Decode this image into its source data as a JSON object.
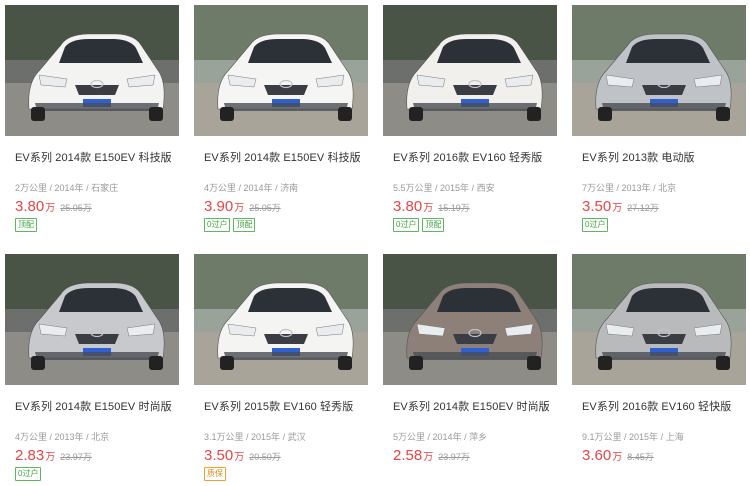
{
  "listings": [
    {
      "title": "EV系列 2014款 E150EV 科技版",
      "mileage": "2万公里",
      "year": "2014年",
      "city": "石家庄",
      "price": "3.80",
      "unit": "万",
      "original_price": "25.05万",
      "tags": [
        "顶配"
      ],
      "car_color": "#f3f3f2"
    },
    {
      "title": "EV系列 2014款 E150EV 科技版",
      "mileage": "4万公里",
      "year": "2014年",
      "city": "济南",
      "price": "3.90",
      "unit": "万",
      "original_price": "25.05万",
      "tags": [
        "0过户",
        "顶配"
      ],
      "car_color": "#f5f5f3"
    },
    {
      "title": "EV系列 2016款 EV160 轻秀版",
      "mileage": "5.5万公里",
      "year": "2015年",
      "city": "西安",
      "price": "3.80",
      "unit": "万",
      "original_price": "15.19万",
      "tags": [
        "0过户",
        "顶配"
      ],
      "car_color": "#f1f0ec"
    },
    {
      "title": "EV系列 2013款 电动版",
      "mileage": "7万公里",
      "year": "2013年",
      "city": "北京",
      "price": "3.50",
      "unit": "万",
      "original_price": "27.12万",
      "tags": [
        "0过户"
      ],
      "car_color": "#bfc2c6"
    },
    {
      "title": "EV系列 2014款 E150EV 时尚版",
      "mileage": "4万公里",
      "year": "2013年",
      "city": "北京",
      "price": "2.83",
      "unit": "万",
      "original_price": "23.97万",
      "tags": [
        "0过户"
      ],
      "car_color": "#c7c9cc"
    },
    {
      "title": "EV系列 2015款 EV160 轻秀版",
      "mileage": "3.1万公里",
      "year": "2015年",
      "city": "武汉",
      "price": "3.50",
      "unit": "万",
      "original_price": "20.50万",
      "tags": [
        "质保"
      ],
      "car_color": "#f4f4f2"
    },
    {
      "title": "EV系列 2014款 E150EV 时尚版",
      "mileage": "5万公里",
      "year": "2014年",
      "city": "萍乡",
      "price": "2.58",
      "unit": "万",
      "original_price": "23.97万",
      "tags": [],
      "car_color": "#8c8078"
    },
    {
      "title": "EV系列 2016款 EV160 轻快版",
      "mileage": "9.1万公里",
      "year": "2015年",
      "city": "上海",
      "price": "3.60",
      "unit": "万",
      "original_price": "8.45万",
      "tags": [],
      "car_color": "#b9babb"
    }
  ],
  "meta_separator": " / ",
  "tag_styles": {
    "质保": "orange"
  }
}
